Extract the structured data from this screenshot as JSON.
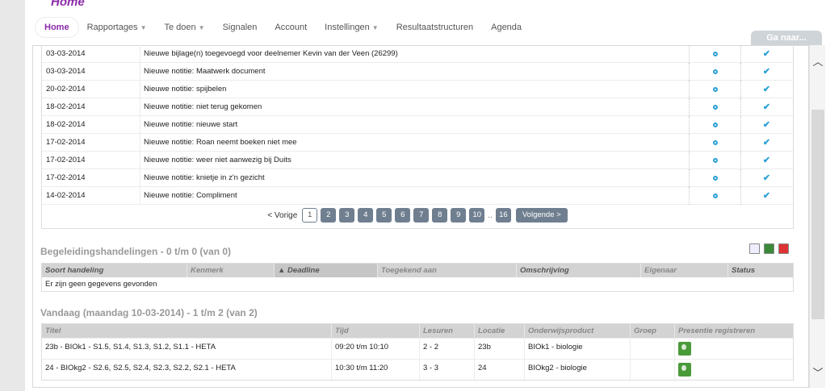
{
  "header": {
    "title": "Home",
    "goto_label": "Ga naar..."
  },
  "nav": [
    {
      "label": "Home",
      "dropdown": false
    },
    {
      "label": "Rapportages",
      "dropdown": true
    },
    {
      "label": "Te doen",
      "dropdown": true
    },
    {
      "label": "Signalen",
      "dropdown": false
    },
    {
      "label": "Account",
      "dropdown": false
    },
    {
      "label": "Instellingen",
      "dropdown": true
    },
    {
      "label": "Resultaatstructuren",
      "dropdown": false
    },
    {
      "label": "Agenda",
      "dropdown": false
    }
  ],
  "notes": [
    {
      "date": "03-03-2014",
      "text": "Nieuwe bijlage(n) toegevoegd voor deelnemer Kevin van der Veen (26299)"
    },
    {
      "date": "03-03-2014",
      "text": "Nieuwe notitie: Maatwerk document"
    },
    {
      "date": "20-02-2014",
      "text": "Nieuwe notitie: spijbelen"
    },
    {
      "date": "18-02-2014",
      "text": "Nieuwe notitie: niet terug gekomen"
    },
    {
      "date": "18-02-2014",
      "text": "Nieuwe notitie: nieuwe start"
    },
    {
      "date": "17-02-2014",
      "text": "Nieuwe notitie: Roan neemt boeken niet mee"
    },
    {
      "date": "17-02-2014",
      "text": "Nieuwe notitie: weer niet aanwezig bij Duits"
    },
    {
      "date": "17-02-2014",
      "text": "Nieuwe notitie: knietje in z'n gezicht"
    },
    {
      "date": "14-02-2014",
      "text": "Nieuwe notitie: Compliment"
    }
  ],
  "pager": {
    "prev": "< Vorige",
    "pages": [
      "1",
      "2",
      "3",
      "4",
      "5",
      "6",
      "7",
      "8",
      "9",
      "10"
    ],
    "ellipsis": "..",
    "last": "16",
    "next": "Volgende >"
  },
  "begeleiding": {
    "title": "Begeleidingshandelingen - 0 t/m 0 (van 0)",
    "columns": [
      "Soort handeling",
      "Kenmerk",
      "Deadline",
      "Toegekend aan",
      "Omschrijving",
      "Eigenaar",
      "Status"
    ],
    "empty": "Er zijn geen gegevens gevonden"
  },
  "vandaag": {
    "title": "Vandaag (maandag 10-03-2014) - 1 t/m 2 (van 2)",
    "columns": [
      "Titel",
      "Tijd",
      "Lesuren",
      "Locatie",
      "Onderwijsproduct",
      "Groep",
      "Presentie registreren"
    ],
    "rows": [
      {
        "titel": "23b - BIOk1 - S1.5, S1.4, S1.3, S1.2, S1.1 - HETA",
        "tijd": "09:20 t/m 10:10",
        "lesuren": "2 - 2",
        "locatie": "23b",
        "product": "BIOk1 - biologie",
        "groep": ""
      },
      {
        "titel": "24 - BIOkg2 - S2.6, S2.5, S2.4, S2.3, S2.2, S2.1 - HETA",
        "tijd": "10:30 t/m 11:20",
        "lesuren": "3 - 3",
        "locatie": "24",
        "product": "BIOkg2 - biologie",
        "groep": ""
      }
    ]
  }
}
